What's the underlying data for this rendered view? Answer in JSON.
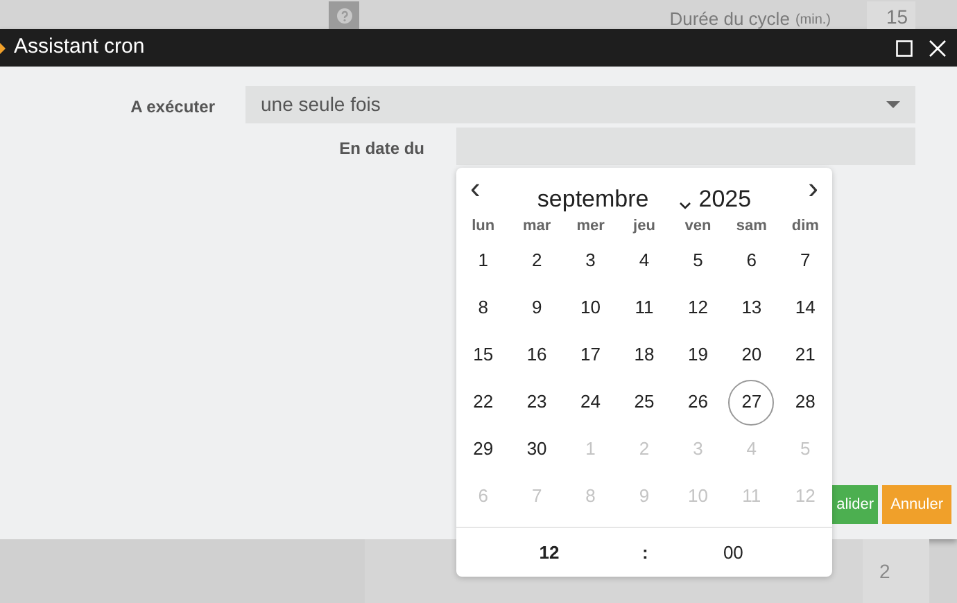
{
  "background": {
    "cycle_label": "Durée du cycle",
    "cycle_unit": "(min.)",
    "cycle_value": "15",
    "row_value": "2"
  },
  "dialog": {
    "title": "Assistant cron",
    "run_label": "A exécuter",
    "run_value": "une seule fois",
    "date_label": "En date du",
    "buttons": [
      {
        "label": "alider",
        "kind": "confirm"
      },
      {
        "label": "Annuler",
        "kind": "cancel"
      }
    ]
  },
  "calendar": {
    "prev": "‹",
    "next": "›",
    "month": "septembre",
    "year": "2025",
    "weekdays": [
      "lun",
      "mar",
      "mer",
      "jeu",
      "ven",
      "sam",
      "dim"
    ],
    "weeks": [
      [
        {
          "day": "1",
          "in_month": true,
          "selected": false
        },
        {
          "day": "2",
          "in_month": true,
          "selected": false
        },
        {
          "day": "3",
          "in_month": true,
          "selected": false
        },
        {
          "day": "4",
          "in_month": true,
          "selected": false
        },
        {
          "day": "5",
          "in_month": true,
          "selected": false
        },
        {
          "day": "6",
          "in_month": true,
          "selected": false
        },
        {
          "day": "7",
          "in_month": true,
          "selected": false
        }
      ],
      [
        {
          "day": "8",
          "in_month": true,
          "selected": false
        },
        {
          "day": "9",
          "in_month": true,
          "selected": false
        },
        {
          "day": "10",
          "in_month": true,
          "selected": false
        },
        {
          "day": "11",
          "in_month": true,
          "selected": false
        },
        {
          "day": "12",
          "in_month": true,
          "selected": false
        },
        {
          "day": "13",
          "in_month": true,
          "selected": false
        },
        {
          "day": "14",
          "in_month": true,
          "selected": false
        }
      ],
      [
        {
          "day": "15",
          "in_month": true,
          "selected": false
        },
        {
          "day": "16",
          "in_month": true,
          "selected": false
        },
        {
          "day": "17",
          "in_month": true,
          "selected": false
        },
        {
          "day": "18",
          "in_month": true,
          "selected": false
        },
        {
          "day": "19",
          "in_month": true,
          "selected": false
        },
        {
          "day": "20",
          "in_month": true,
          "selected": false
        },
        {
          "day": "21",
          "in_month": true,
          "selected": false
        }
      ],
      [
        {
          "day": "22",
          "in_month": true,
          "selected": false
        },
        {
          "day": "23",
          "in_month": true,
          "selected": false
        },
        {
          "day": "24",
          "in_month": true,
          "selected": false
        },
        {
          "day": "25",
          "in_month": true,
          "selected": false
        },
        {
          "day": "26",
          "in_month": true,
          "selected": false
        },
        {
          "day": "27",
          "in_month": true,
          "selected": true
        },
        {
          "day": "28",
          "in_month": true,
          "selected": false
        }
      ],
      [
        {
          "day": "29",
          "in_month": true,
          "selected": false
        },
        {
          "day": "30",
          "in_month": true,
          "selected": false
        },
        {
          "day": "1",
          "in_month": false,
          "selected": false
        },
        {
          "day": "2",
          "in_month": false,
          "selected": false
        },
        {
          "day": "3",
          "in_month": false,
          "selected": false
        },
        {
          "day": "4",
          "in_month": false,
          "selected": false
        },
        {
          "day": "5",
          "in_month": false,
          "selected": false
        }
      ],
      [
        {
          "day": "6",
          "in_month": false,
          "selected": false
        },
        {
          "day": "7",
          "in_month": false,
          "selected": false
        },
        {
          "day": "8",
          "in_month": false,
          "selected": false
        },
        {
          "day": "9",
          "in_month": false,
          "selected": false
        },
        {
          "day": "10",
          "in_month": false,
          "selected": false
        },
        {
          "day": "11",
          "in_month": false,
          "selected": false
        },
        {
          "day": "12",
          "in_month": false,
          "selected": false
        }
      ]
    ],
    "hour": "12",
    "separator": ":",
    "minute": "00"
  }
}
